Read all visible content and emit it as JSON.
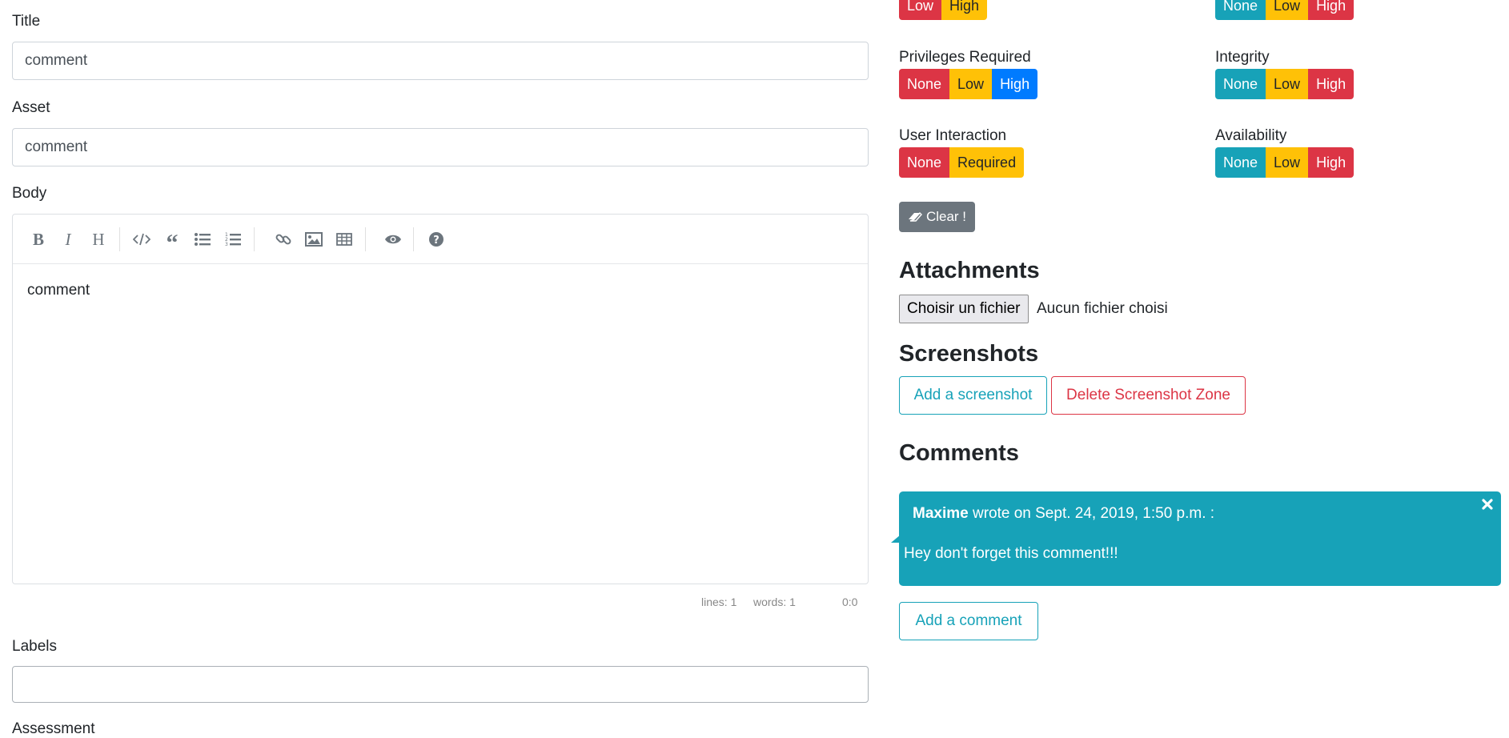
{
  "form": {
    "title_label": "Title",
    "title_value": "comment",
    "asset_label": "Asset",
    "asset_value": "comment",
    "body_label": "Body",
    "body_value": "comment",
    "labels_label": "Labels",
    "labels_value": "",
    "assessment_label": "Assessment"
  },
  "editor": {
    "toolbar_icons": [
      "bold-icon",
      "italic-icon",
      "heading-icon",
      "code-icon",
      "quote-icon",
      "unordered-list-icon",
      "ordered-list-icon",
      "link-icon",
      "image-icon",
      "table-icon",
      "preview-icon",
      "help-icon"
    ],
    "status": {
      "lines": "lines: 1",
      "words": "words: 1",
      "cursor": "0:0"
    }
  },
  "cvss": {
    "top_left_options": [
      "Low",
      "High"
    ],
    "top_right_options": [
      "None",
      "Low",
      "High"
    ],
    "privileges": {
      "label": "Privileges Required",
      "options": [
        "None",
        "Low",
        "High"
      ],
      "selected": "High"
    },
    "integrity": {
      "label": "Integrity",
      "options": [
        "None",
        "Low",
        "High"
      ]
    },
    "user_interaction": {
      "label": "User Interaction",
      "options": [
        "None",
        "Required"
      ]
    },
    "availability": {
      "label": "Availability",
      "options": [
        "None",
        "Low",
        "High"
      ]
    },
    "clear_label": "Clear !"
  },
  "attachments": {
    "heading": "Attachments",
    "choose_label": "Choisir un fichier",
    "no_file_text": "Aucun fichier choisi"
  },
  "screenshots": {
    "heading": "Screenshots",
    "add_label": "Add a screenshot",
    "delete_label": "Delete Screenshot Zone"
  },
  "comments": {
    "heading": "Comments",
    "items": [
      {
        "author": "Maxime",
        "meta": " wrote on Sept. 24, 2019, 1:50 p.m. :",
        "text": "Hey don't forget this comment!!!"
      }
    ],
    "add_label": "Add a comment"
  },
  "colors": {
    "red": "#dc3545",
    "yellow": "#ffc107",
    "blue": "#007bff",
    "teal": "#17a2b8",
    "gray": "#6c757d"
  }
}
